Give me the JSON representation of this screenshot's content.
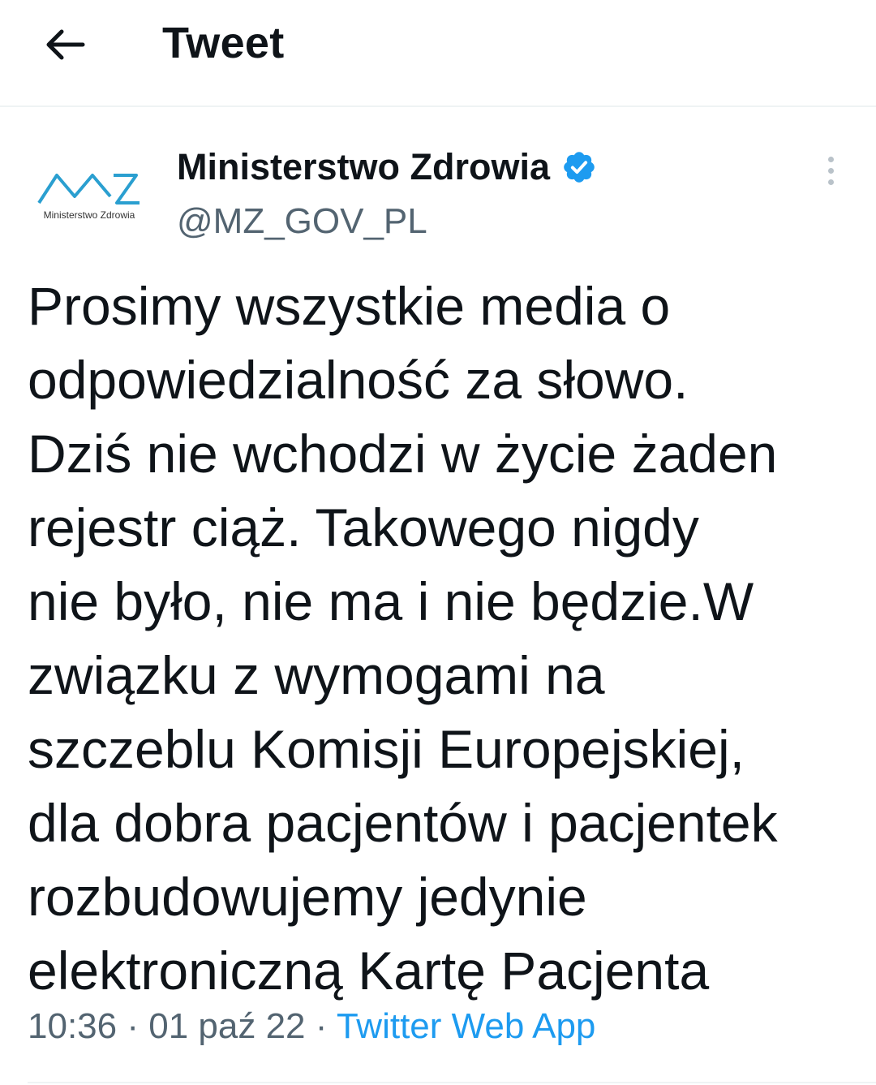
{
  "header": {
    "title": "Tweet",
    "back_icon": "arrow-left-icon"
  },
  "account": {
    "name": "Ministerstwo Zdrowia",
    "handle": "@MZ_GOV_PL",
    "avatar_logo_text": "Ministerstwo Zdrowia",
    "verified_color": "#1d9bf0"
  },
  "tweet": {
    "lines": [
      "Prosimy wszystkie media o",
      "odpowiedzialność za słowo.",
      "Dziś nie wchodzi w życie żaden",
      "rejestr ciąż. Takowego nigdy",
      "nie było, nie ma i nie będzie.W",
      "związku z wymogami na",
      "szczeblu Komisji Europejskiej,",
      "dla dobra pacjentów i pacjentek",
      "rozbudowujemy jedynie",
      "elektroniczną Kartę Pacjenta"
    ],
    "time": "10:36",
    "date": "01 paź 22",
    "separator": "·",
    "source": "Twitter Web App"
  }
}
